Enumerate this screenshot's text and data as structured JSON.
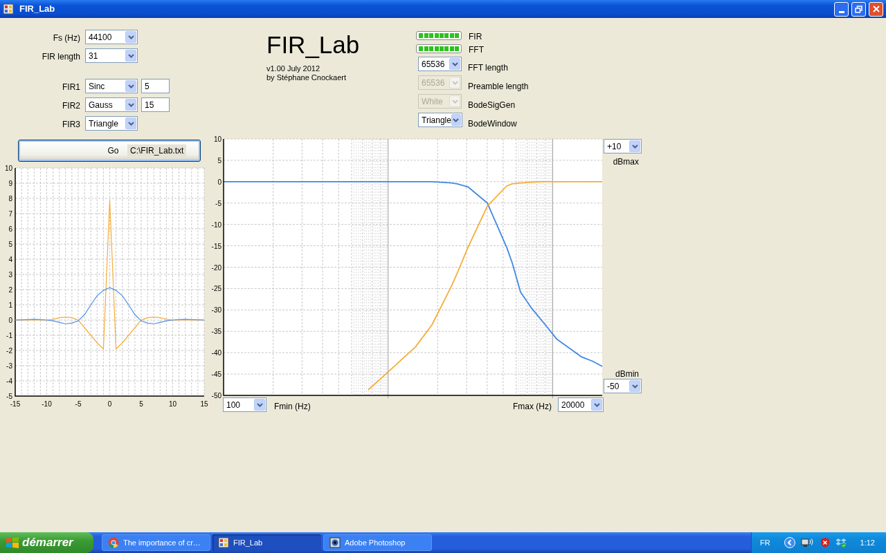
{
  "window": {
    "title": "FIR_Lab"
  },
  "settings": [
    {
      "label": "Fs (Hz)",
      "value": "44100"
    },
    {
      "label": "FIR length",
      "value": "31"
    }
  ],
  "filters": [
    {
      "label": "FIR1",
      "value": "Sinc",
      "param": "5"
    },
    {
      "label": "FIR2",
      "value": "Gauss",
      "param": "15"
    },
    {
      "label": "FIR3",
      "value": "Triangle"
    }
  ],
  "go_button": {
    "label": "Go",
    "file": "C:\\FIR_Lab.txt"
  },
  "app_title": "FIR_Lab",
  "version": "v1.00 July 2012",
  "author": "by Stéphane Cnockaert",
  "progress": [
    {
      "label": "FIR",
      "level": 1
    },
    {
      "label": "FFT",
      "level": 1
    }
  ],
  "options": [
    {
      "label": "FFT length",
      "value": "65536",
      "disabled": false
    },
    {
      "label": "Preamble length",
      "value": "65536",
      "disabled": true
    },
    {
      "label": "BodeSigGen",
      "value": "White",
      "disabled": true
    },
    {
      "label": "BodeWindow",
      "value": "Triangle",
      "disabled": false
    }
  ],
  "impulse_chart": {
    "chart_data": {
      "type": "line",
      "grid": true,
      "x": [
        -15,
        -14,
        -13,
        -12,
        -11,
        -10,
        -9,
        -8,
        -7,
        -6,
        -5,
        -4,
        -3,
        -2,
        -1,
        0,
        1,
        2,
        3,
        4,
        5,
        6,
        7,
        8,
        9,
        10,
        11,
        12,
        13,
        14,
        15
      ],
      "xlim": [
        -15,
        15
      ],
      "ylim": [
        -5,
        10
      ],
      "xticks": [
        -15,
        -10,
        -5,
        0,
        5,
        10,
        15
      ],
      "yticks": [
        -5,
        -4,
        -3,
        -2,
        -1,
        0,
        1,
        2,
        3,
        4,
        5,
        6,
        7,
        8,
        9,
        10
      ],
      "series": [
        {
          "color": "#f5ad3a",
          "values": [
            0,
            0,
            0,
            0,
            0,
            0,
            0.05,
            0.15,
            0.2,
            0.15,
            0,
            -0.5,
            -1.0,
            -1.5,
            -1.9,
            7.9,
            -1.9,
            -1.5,
            -1.0,
            -0.5,
            0,
            0.15,
            0.2,
            0.15,
            0.05,
            0,
            0,
            0,
            0,
            0,
            0
          ]
        },
        {
          "color": "#4f8fe6",
          "values": [
            0,
            0.02,
            0.03,
            0.05,
            0.03,
            0,
            -0.05,
            -0.15,
            -0.25,
            -0.2,
            -0.05,
            0.35,
            1.0,
            1.6,
            1.95,
            2.13,
            1.95,
            1.6,
            1.0,
            0.35,
            -0.05,
            -0.2,
            -0.25,
            -0.15,
            -0.05,
            0,
            0.03,
            0.05,
            0.03,
            0.02,
            0
          ]
        }
      ]
    }
  },
  "bode_chart": {
    "y_axis_labels": [
      "10",
      "5",
      "0",
      "-5",
      "-10",
      "-15",
      "-20",
      "-25",
      "-30",
      "-35",
      "-40",
      "-45",
      "-50"
    ],
    "db_max": {
      "label": "dBmax",
      "value": "+10"
    },
    "db_min": {
      "label": "dBmin",
      "value": "-50"
    },
    "fmin": {
      "label": "Fmin (Hz)",
      "value": "100"
    },
    "fmax": {
      "label": "Fmax (Hz)",
      "value": "20000"
    }
  },
  "taskbar": {
    "start": "démarrer",
    "tasks": [
      {
        "label": "The importance of cr…",
        "selected": false,
        "kind": "browser"
      },
      {
        "label": "FIR_Lab",
        "selected": true,
        "kind": "app"
      },
      {
        "label": "Adobe Photoshop",
        "selected": false,
        "kind": "photoshop"
      }
    ],
    "language": "FR",
    "clock": "1:12"
  }
}
